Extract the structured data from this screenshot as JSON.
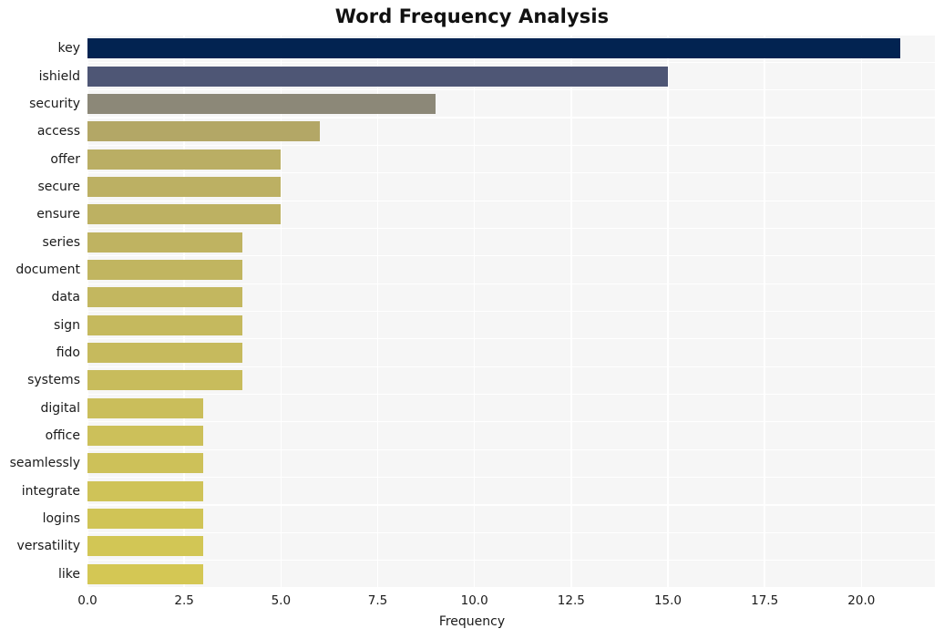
{
  "chart_data": {
    "type": "bar",
    "orientation": "horizontal",
    "title": "Word Frequency Analysis",
    "xlabel": "Frequency",
    "ylabel": "",
    "xlim": [
      0,
      21.9
    ],
    "ylim": [
      0,
      20
    ],
    "grid": true,
    "legend": null,
    "background": "#f6f6f6",
    "gridline_color": "#ffffff",
    "xticks": [
      "0.0",
      "2.5",
      "5.0",
      "7.5",
      "10.0",
      "12.5",
      "15.0",
      "17.5",
      "20.0"
    ],
    "xtick_values": [
      0.0,
      2.5,
      5.0,
      7.5,
      10.0,
      12.5,
      15.0,
      17.5,
      20.0
    ],
    "categories": [
      "key",
      "ishield",
      "security",
      "access",
      "offer",
      "secure",
      "ensure",
      "series",
      "document",
      "data",
      "sign",
      "fido",
      "systems",
      "digital",
      "office",
      "seamlessly",
      "integrate",
      "logins",
      "versatility",
      "like"
    ],
    "values": [
      21,
      15,
      9,
      6,
      5,
      5,
      5,
      4,
      4,
      4,
      4,
      4,
      4,
      3,
      3,
      3,
      3,
      3,
      3,
      3
    ],
    "bar_colors": [
      "#022351",
      "#4e5675",
      "#8c8878",
      "#b3a766",
      "#baae64",
      "#bcb063",
      "#bdb162",
      "#bfb361",
      "#c1b560",
      "#c3b75f",
      "#c5b95e",
      "#c6ba5d",
      "#c8bc5c",
      "#cabe5b",
      "#ccc05a",
      "#cdc159",
      "#cfc358",
      "#d0c456",
      "#d2c655",
      "#d4c754"
    ]
  }
}
